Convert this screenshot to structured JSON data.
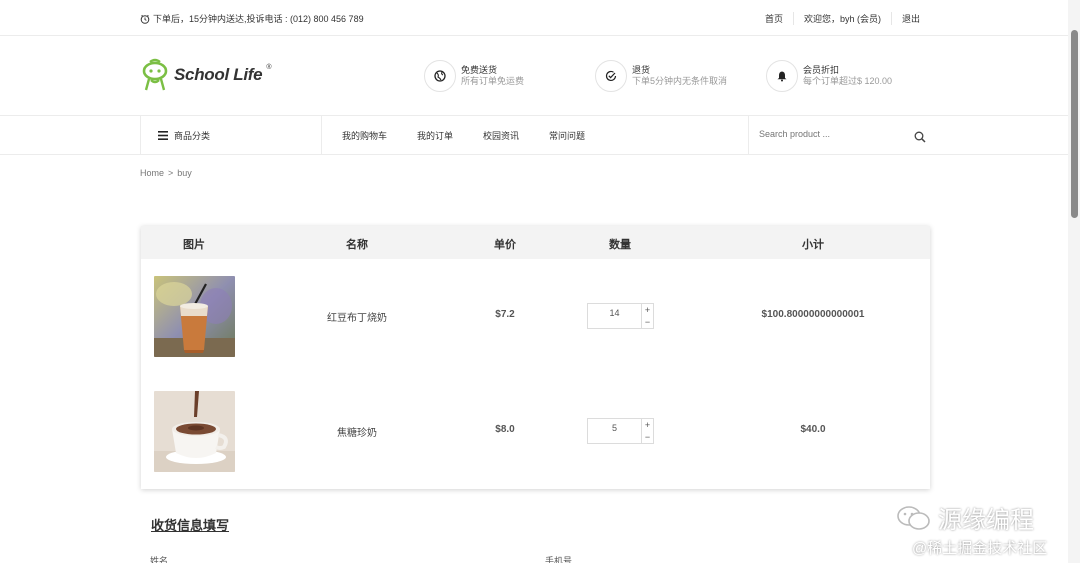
{
  "topbar": {
    "notice": "下单后，15分钟内送达,投诉电话 : (012) 800 456 789",
    "links": [
      "首页",
      "欢迎您，byh (会员)",
      "退出"
    ]
  },
  "brand": {
    "logo_text": "School Life",
    "reg_mark": "®",
    "accent_color": "#7bbf44"
  },
  "features": [
    {
      "icon": "globe-icon",
      "title": "免费送货",
      "desc": "所有订单免运费"
    },
    {
      "icon": "check-circle-icon",
      "title": "退货",
      "desc": "下单5分钟内无条件取消"
    },
    {
      "icon": "bell-icon",
      "title": "会员折扣",
      "desc": "每个订单超过$ 120.00"
    }
  ],
  "nav": {
    "category_label": "商品分类",
    "menu": [
      "我的购物车",
      "我的订单",
      "校园资讯",
      "常问问题"
    ],
    "search_placeholder": "Search product ..."
  },
  "breadcrumb": [
    "Home",
    ">",
    "buy"
  ],
  "cart": {
    "headers": [
      "图片",
      "名称",
      "单价",
      "数量",
      "小计"
    ],
    "items": [
      {
        "name": "红豆布丁烧奶",
        "price": "$7.2",
        "qty": "14",
        "subtotal": "$100.80000000000001"
      },
      {
        "name": "焦糖珍奶",
        "price": "$8.0",
        "qty": "5",
        "subtotal": "$40.0"
      }
    ],
    "plus": "+",
    "minus": "−"
  },
  "form": {
    "section_title": "收货信息填写",
    "name_label": "姓名",
    "phone_label": "手机号"
  },
  "watermark": {
    "line1": "源缘编程",
    "line2": "@稀土掘金技术社区"
  }
}
